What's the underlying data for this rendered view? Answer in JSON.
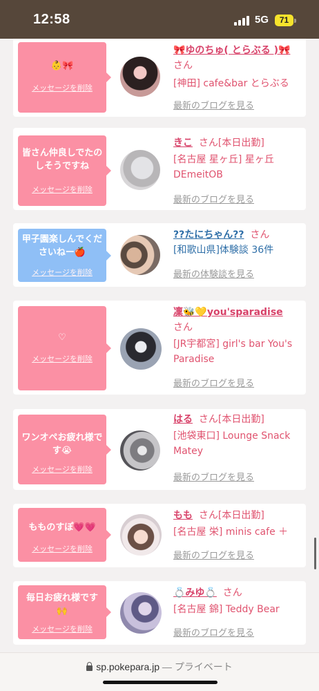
{
  "status": {
    "time": "12:58",
    "network": "5G",
    "battery": "71"
  },
  "delete_label": "メッセージを削除",
  "latest_blog": "最新のブログを見る",
  "latest_review": "最新の体験談を見る",
  "san": "さん",
  "cards": [
    {
      "message": "👶🎀",
      "name": "🎀ゆのちゅ( とらぶる )🎀",
      "tag": "",
      "shop": "[神田] cafe&bar とらぶる",
      "link": "最新のブログを見る",
      "bubble": "pink"
    },
    {
      "message": "皆さん仲良しでたのしそうですね",
      "name": "きこ",
      "tag": "[本日出勤]",
      "shop": "[名古屋 星ヶ丘] 星ヶ丘 DEmeitOB",
      "link": "最新のブログを見る",
      "bubble": "pink"
    },
    {
      "message": "甲子園楽しんでくださいねー🍎",
      "name": "??たにちゃん??",
      "tag": "",
      "shop": "[和歌山県]体験談 36件",
      "link": "最新の体験談を見る",
      "bubble": "blue"
    },
    {
      "message": "♡",
      "name": "凜🐝💛you'sparadise",
      "tag": "",
      "shop": "[JR宇都宮] girl's bar You's Paradise",
      "link": "最新のブログを見る",
      "bubble": "pink"
    },
    {
      "message": "ワンオペお疲れ様です😭",
      "name": "はる",
      "tag": "[本日出勤]",
      "shop": "[池袋東口] Lounge Snack Matey",
      "link": "最新のブログを見る",
      "bubble": "pink"
    },
    {
      "message": "もものすぽ💗💗",
      "name": "もも",
      "tag": "[本日出勤]",
      "shop": "[名古屋 栄] minis cafe ＋",
      "link": "最新のブログを見る",
      "bubble": "pink"
    },
    {
      "message": "毎日お疲れ様です🙌",
      "name": "💍みゆ💍",
      "tag": "",
      "shop": "[名古屋 錦] Teddy Bear",
      "link": "最新のブログを見る",
      "bubble": "pink"
    }
  ],
  "browser": {
    "url": "sp.pokepara.jp",
    "separator": "—",
    "mode": "プライベート"
  }
}
